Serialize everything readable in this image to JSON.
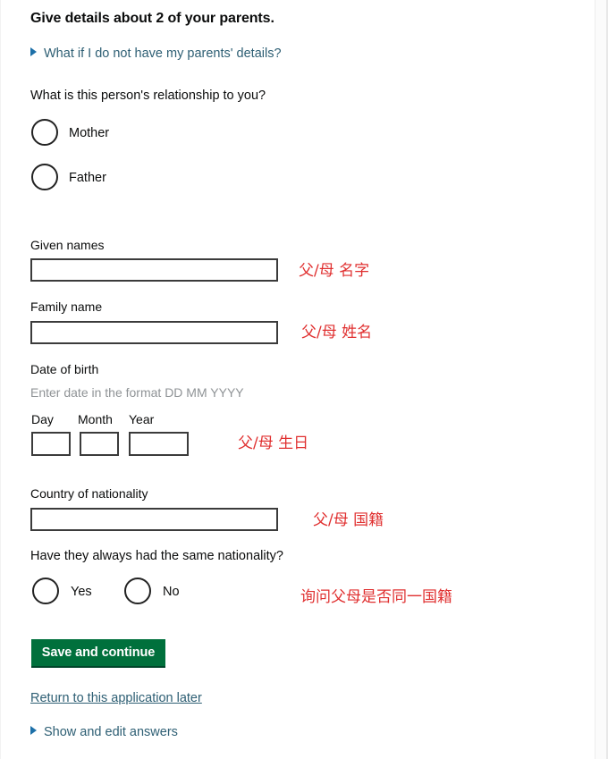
{
  "page": {
    "heading": "Give details about 2 of your parents.",
    "details_toggle": "What if I do not have my parents' details?",
    "show_edit_toggle": "Show and edit answers",
    "return_link": "Return to this application later"
  },
  "relationship": {
    "question": "What is this person's relationship to you?",
    "options": [
      {
        "label": "Mother",
        "selected": false
      },
      {
        "label": "Father",
        "selected": false
      }
    ]
  },
  "fields": {
    "given_names": {
      "label": "Given names",
      "value": "",
      "placeholder": ""
    },
    "family_name": {
      "label": "Family name",
      "value": "",
      "placeholder": ""
    },
    "date_of_birth": {
      "label": "Date of birth",
      "hint": "Enter date in the format DD MM YYYY",
      "day": {
        "label": "Day",
        "value": ""
      },
      "month": {
        "label": "Month",
        "value": ""
      },
      "year": {
        "label": "Year",
        "value": ""
      }
    },
    "country_of_nationality": {
      "label": "Country of nationality",
      "value": "",
      "placeholder": ""
    }
  },
  "nationality_question": {
    "question": "Have they always had the same nationality?",
    "options": [
      {
        "label": "Yes",
        "selected": false
      },
      {
        "label": "No",
        "selected": false
      }
    ]
  },
  "actions": {
    "save_and_continue": "Save and continue"
  },
  "annotations": {
    "given_names": "父/母 名字",
    "family_name": "父/母 姓名",
    "date_of_birth": "父/母 生日",
    "country_of_nationality": "父/母 国籍",
    "nationality_question": "询问父母是否同一国籍"
  },
  "colors": {
    "button_green": "#00703c",
    "link_teal": "#2e5f74",
    "annotation_red": "#e03030",
    "hint_grey": "#8f9396",
    "text_black": "#0b0c0c"
  }
}
